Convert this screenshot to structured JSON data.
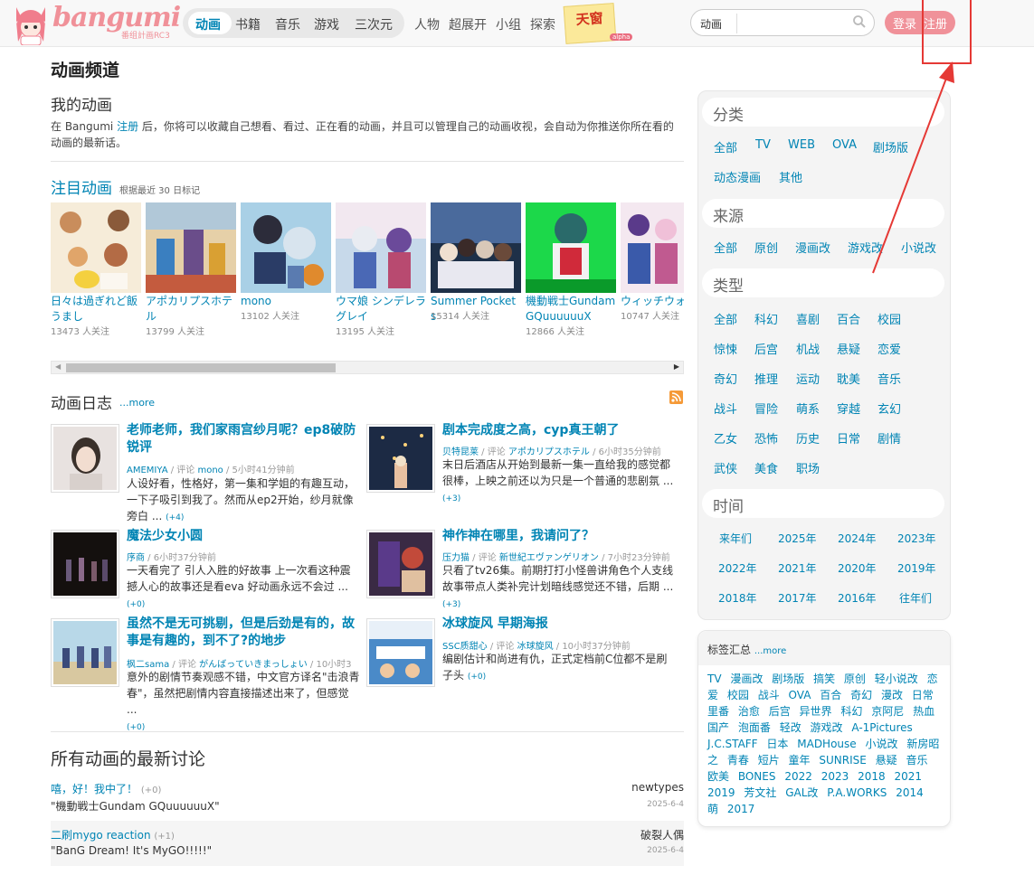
{
  "header": {
    "logo_text": "bangumi",
    "logo_sub": "番组計画RC3",
    "nav": [
      "动画",
      "书籍",
      "音乐",
      "游戏",
      "三次元"
    ],
    "nav2": [
      "人物",
      "超展开",
      "小组",
      "探索"
    ],
    "tianchuang": "天窗",
    "alpha": "alpha",
    "search_type": "动画",
    "search_placeholder": "",
    "login": "登录",
    "register": "注册"
  },
  "main": {
    "page_title": "动画频道",
    "my_title": "我的动画",
    "my_desc_pre": "在 Bangumi ",
    "my_desc_link": "注册",
    "my_desc_post": " 后，你将可以收藏自己想看、看过、正在看的动画，并且可以管理自己的动画收视，会自动为你推送你所在看的动画的最新话。",
    "hot_title": "注目动画",
    "hot_sub": "根据最近 30 日标记",
    "hot": [
      {
        "name": "日々は過ぎれど飯うまし",
        "fans": "13473 人关注"
      },
      {
        "name": "アポカリプスホテル",
        "fans": "13799 人关注"
      },
      {
        "name": "mono",
        "fans": "13102 人关注"
      },
      {
        "name": "ウマ娘 シンデレラグレイ",
        "fans": "13195 人关注"
      },
      {
        "name": "Summer Pockets",
        "fans": "15314 人关注"
      },
      {
        "name": "機動戦士Gundam GQuuuuuuX",
        "fans": "12866 人关注"
      },
      {
        "name": "ウィッチウォ",
        "fans": "10747 人关注"
      }
    ],
    "blog_title": "动画日志",
    "blog_more": "...more",
    "blogs": [
      {
        "title": "老师老师，我们家雨宫纱月呢？ep8破防锐评",
        "user": "AMEMIYA",
        "mid": " / 评论 ",
        "anime": "mono",
        "time": " / 5小时41分钟前",
        "body": "人设好看，性格好，第一集和学姐的有趣互动，一下子吸引到我了。然而从ep2开始，纱月就像旁白 ...",
        "count": "(+4)"
      },
      {
        "title": "剧本完成度之高，cyp真王朝了",
        "user": "贝特昆莱",
        "mid": " / 评论 ",
        "anime": "アポカリプスホテル",
        "time": " / 6小时35分钟前",
        "body": "末日后酒店从开始到最新一集一直给我的感觉都很棒，上映之前还以为只是一个普通的悲剧氛 ...",
        "count": "(+3)"
      },
      {
        "title": "魔法少女小圆",
        "user": "序商",
        "mid": "",
        "anime": "",
        "time": " / 6小时37分钟前",
        "body": "一天看完了 引人入胜的好故事 上一次看这种震撼人心的故事还是看eva 好动画永远不会过 ...",
        "count": "(+0)"
      },
      {
        "title": "神作神在哪里，我请问了？",
        "user": "压力猫",
        "mid": " / 评论 ",
        "anime": "新世紀エヴァンゲリオン",
        "time": " / 7小时23分钟前",
        "body": "只看了tv26集。前期打打小怪兽讲角色个人支线故事带点人类补完计划暗线感觉还不错，后期 ...",
        "count": "(+3)"
      },
      {
        "title": "虽然不是无可挑剔，但是后劲是有的，故事是有趣的，到不了?的地步",
        "user": "枫二sama",
        "mid": " / 评论 ",
        "anime": "がんばっていきまっしょい",
        "time": " / 10小时3",
        "body": "意外的剧情节奏观感不错，中文官方译名\"击浪青春\"，虽然把剧情内容直接描述出来了，但感觉 ...",
        "count": "(+0)"
      },
      {
        "title": "冰球旋风 早期海报",
        "user": "SSC质甜心",
        "mid": " / 评论 ",
        "anime": "冰球旋风",
        "time": " / 10小时37分钟前",
        "body": "编剧估计和尚进有仇，正式定档前C位都不是刷子头",
        "count": "(+0)"
      }
    ],
    "disc_title": "所有动画的最新讨论",
    "discussions": [
      {
        "topic": "嘻，好！我中了！",
        "count": "(+0)",
        "sub": "\"機動戦士Gundam GQuuuuuuX\"",
        "user": "newtypes",
        "date": "2025-6-4"
      },
      {
        "topic": "二刷mygo reaction",
        "count": "(+1)",
        "sub": "\"BanG Dream! It's MyGO!!!!!\"",
        "user": "破裂人偶",
        "date": "2025-6-4"
      }
    ]
  },
  "sidebar": {
    "cat_title": "分类",
    "cats": [
      "全部",
      "TV",
      "WEB",
      "OVA",
      "剧场版",
      "动态漫画",
      "其他"
    ],
    "src_title": "来源",
    "srcs": [
      "全部",
      "原创",
      "漫画改",
      "游戏改",
      "小说改"
    ],
    "type_title": "类型",
    "types": [
      "全部",
      "科幻",
      "喜剧",
      "百合",
      "校园",
      "惊悚",
      "后宫",
      "机战",
      "悬疑",
      "恋爱",
      "奇幻",
      "推理",
      "运动",
      "耽美",
      "音乐",
      "战斗",
      "冒险",
      "萌系",
      "穿越",
      "玄幻",
      "乙女",
      "恐怖",
      "历史",
      "日常",
      "剧情",
      "武侠",
      "美食",
      "职场"
    ],
    "time_title": "时间",
    "times": [
      "来年们",
      "2025年",
      "2024年",
      "2023年",
      "2022年",
      "2021年",
      "2020年",
      "2019年",
      "2018年",
      "2017年",
      "2016年",
      "往年们"
    ],
    "tag_title": "标签汇总",
    "tag_more": "...more",
    "tags": [
      "TV",
      "漫画改",
      "剧场版",
      "搞笑",
      "原创",
      "轻小说改",
      "恋爱",
      "校园",
      "战斗",
      "OVA",
      "百合",
      "奇幻",
      "漫改",
      "日常",
      "里番",
      "治愈",
      "后宫",
      "异世界",
      "科幻",
      "京阿尼",
      "热血",
      "国产",
      "泡面番",
      "轻改",
      "游戏改",
      "A-1Pictures",
      "J.C.STAFF",
      "日本",
      "MADHouse",
      "小说改",
      "新房昭之",
      "青春",
      "短片",
      "童年",
      "SUNRISE",
      "悬疑",
      "音乐",
      "欧美",
      "BONES",
      "2022",
      "2023",
      "2018",
      "2021",
      "2019",
      "芳文社",
      "GAL改",
      "P.A.WORKS",
      "2014",
      "萌",
      "2017"
    ]
  },
  "colors": {
    "link": "#0084b4",
    "brand": "#f09199",
    "annotation": "#e53935"
  }
}
